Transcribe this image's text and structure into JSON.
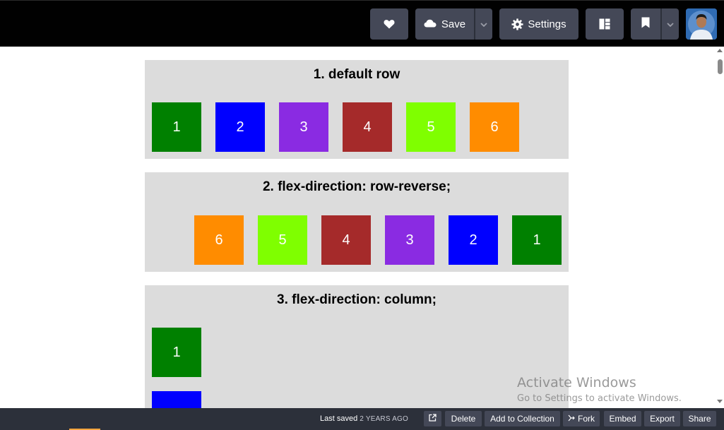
{
  "topbar": {
    "heart_icon": "heart-icon",
    "save_label": "Save",
    "settings_label": "Settings",
    "colors": {
      "bar": "#010101",
      "button": "#444857"
    }
  },
  "panels": [
    {
      "title": "1. default row",
      "boxes": [
        "1",
        "2",
        "3",
        "4",
        "5",
        "6"
      ]
    },
    {
      "title": "2. flex-direction: row-reverse;",
      "boxes": [
        "6",
        "5",
        "4",
        "3",
        "2",
        "1"
      ]
    },
    {
      "title": "3. flex-direction: column;",
      "boxes": [
        "1",
        ""
      ]
    }
  ],
  "box_colors": {
    "1": "#008000",
    "2": "#0000ff",
    "3": "#8a2be2",
    "4": "#a52a2a",
    "5": "#7fff00",
    "6": "#ff8c00"
  },
  "watermark": {
    "line1": "Activate Windows",
    "line2": "Go to Settings to activate Windows."
  },
  "footer": {
    "last_saved_label": "Last saved",
    "last_saved_ago": "2 YEARS AGO",
    "delete": "Delete",
    "add_to_collection": "Add to Collection",
    "fork": "Fork",
    "embed": "Embed",
    "export": "Export",
    "share": "Share"
  }
}
